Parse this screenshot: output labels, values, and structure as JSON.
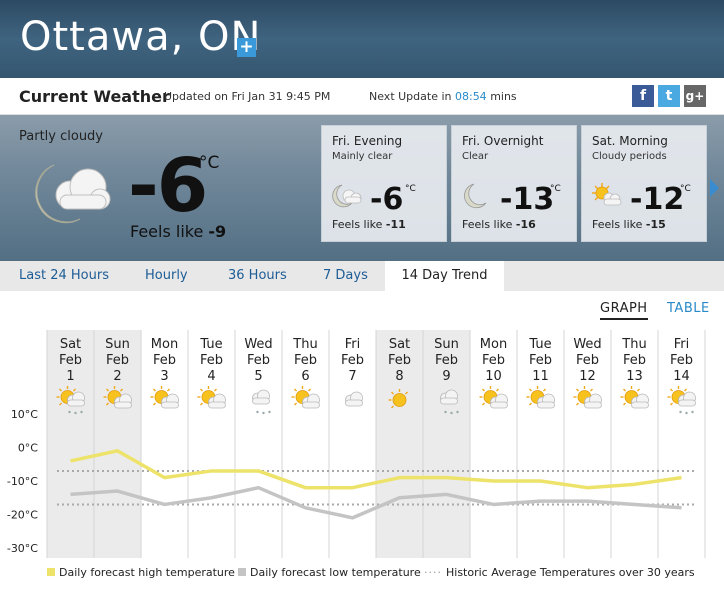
{
  "header": {
    "city": "Ottawa, ON",
    "add_label": "+"
  },
  "current_bar": {
    "title": "Current Weather",
    "updated": "Updated on Fri Jan 31 9:45 PM",
    "next_label": "Next Update in",
    "countdown": "08:54",
    "countdown_unit": "mins",
    "social": [
      "f",
      "t",
      "g+"
    ]
  },
  "current": {
    "condition": "Partly cloudy",
    "temp": "-6",
    "unit": "°C",
    "feels_label": "Feels like",
    "feels_value": "-9",
    "icon": "moon-cloud-icon"
  },
  "forecast_cards": [
    {
      "period": "Fri. Evening",
      "desc": "Mainly clear",
      "temp": "-6",
      "unit": "°C",
      "feels_label": "Feels like",
      "feels": "-11",
      "icon": "moon-cloud-icon"
    },
    {
      "period": "Fri. Overnight",
      "desc": "Clear",
      "temp": "-13",
      "unit": "°C",
      "feels_label": "Feels like",
      "feels": "-16",
      "icon": "moon-icon"
    },
    {
      "period": "Sat. Morning",
      "desc": "Cloudy periods",
      "temp": "-12",
      "unit": "°C",
      "feels_label": "Feels like",
      "feels": "-15",
      "icon": "sun-cloud-icon"
    }
  ],
  "tabs": [
    "Last 24 Hours",
    "Hourly",
    "36 Hours",
    "7 Days",
    "14 Day Trend"
  ],
  "active_tab": "14 Day Trend",
  "view_toggle": {
    "graph": "GRAPH",
    "table": "TABLE",
    "active": "GRAPH"
  },
  "colors": {
    "high": "#ede36a",
    "low": "#c4c4c4",
    "historic": "#aaaaaa",
    "link": "#2a8ac8"
  },
  "chart_data": {
    "type": "line",
    "categories": [
      "Sat Feb 1",
      "Sun Feb 2",
      "Mon Feb 3",
      "Tue Feb 4",
      "Wed Feb 5",
      "Thu Feb 6",
      "Fri Feb 7",
      "Sat Feb 8",
      "Sun Feb 9",
      "Mon Feb 10",
      "Tue Feb 11",
      "Wed Feb 12",
      "Thu Feb 13",
      "Fri Feb 14"
    ],
    "days": [
      {
        "dow": "Sat",
        "mon": "Feb",
        "day": "1",
        "icon": "snow-cloud-sun-icon",
        "weekend": true
      },
      {
        "dow": "Sun",
        "mon": "Feb",
        "day": "2",
        "icon": "sun-cloud-icon",
        "weekend": true
      },
      {
        "dow": "Mon",
        "mon": "Feb",
        "day": "3",
        "icon": "sun-cloud-icon",
        "weekend": false
      },
      {
        "dow": "Tue",
        "mon": "Feb",
        "day": "4",
        "icon": "sun-cloud-icon",
        "weekend": false
      },
      {
        "dow": "Wed",
        "mon": "Feb",
        "day": "5",
        "icon": "snow-cloud-icon",
        "weekend": false
      },
      {
        "dow": "Thu",
        "mon": "Feb",
        "day": "6",
        "icon": "sun-cloud-icon",
        "weekend": false
      },
      {
        "dow": "Fri",
        "mon": "Feb",
        "day": "7",
        "icon": "cloud-icon",
        "weekend": false
      },
      {
        "dow": "Sat",
        "mon": "Feb",
        "day": "8",
        "icon": "sun-icon",
        "weekend": true
      },
      {
        "dow": "Sun",
        "mon": "Feb",
        "day": "9",
        "icon": "snow-cloud-icon",
        "weekend": true
      },
      {
        "dow": "Mon",
        "mon": "Feb",
        "day": "10",
        "icon": "sun-cloud-icon",
        "weekend": false
      },
      {
        "dow": "Tue",
        "mon": "Feb",
        "day": "11",
        "icon": "sun-cloud-icon",
        "weekend": false
      },
      {
        "dow": "Wed",
        "mon": "Feb",
        "day": "12",
        "icon": "sun-cloud-icon",
        "weekend": false
      },
      {
        "dow": "Thu",
        "mon": "Feb",
        "day": "13",
        "icon": "sun-cloud-icon",
        "weekend": false
      },
      {
        "dow": "Fri",
        "mon": "Feb",
        "day": "14",
        "icon": "snow-cloud-sun-icon",
        "weekend": false
      }
    ],
    "series": [
      {
        "name": "Daily forecast high temperature",
        "values": [
          -4,
          -1,
          -9,
          -7,
          -7,
          -12,
          -12,
          -9,
          -9,
          -10,
          -10,
          -12,
          -11,
          -9
        ]
      },
      {
        "name": "Daily forecast low temperature",
        "values": [
          -14,
          -13,
          -17,
          -15,
          -12,
          -18,
          -21,
          -15,
          -14,
          -17,
          -16,
          -16,
          -17,
          -18
        ]
      },
      {
        "name": "Historic Average Temperatures over 30 years",
        "values_high": -7,
        "values_low": -17
      }
    ],
    "yticks": [
      "10°C",
      "0°C",
      "-10°C",
      "-20°C",
      "-30°C"
    ],
    "ylim": [
      -30,
      10
    ]
  },
  "legend": [
    "Daily forecast high temperature",
    "Daily forecast low temperature",
    "Historic Average Temperatures over 30 years"
  ]
}
